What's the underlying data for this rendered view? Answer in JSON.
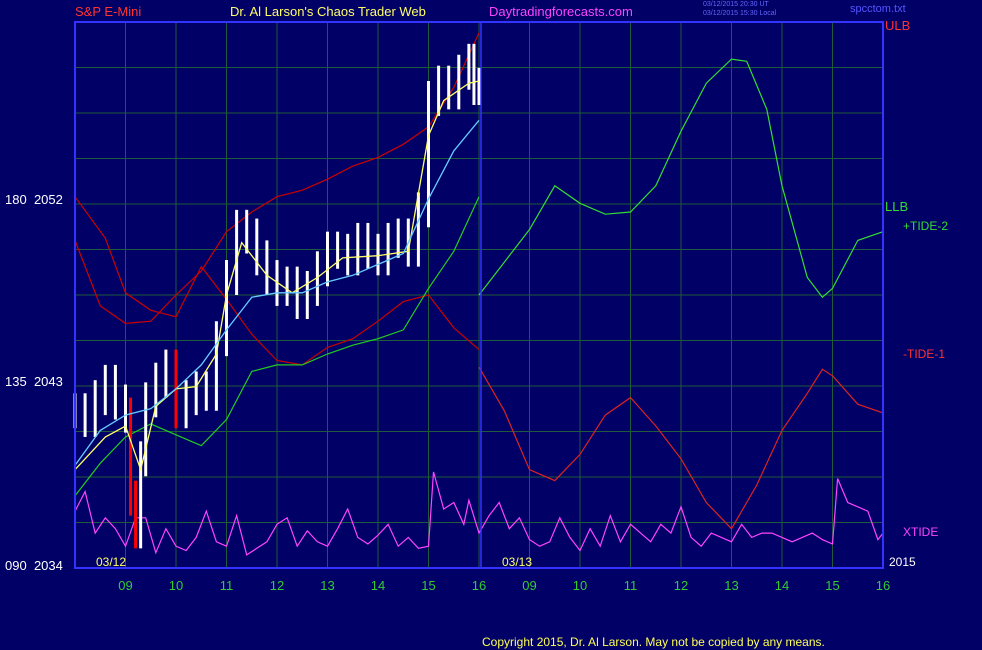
{
  "header": {
    "instrument": "S&P E-Mini",
    "site_title": "Dr. Al Larson's Chaos Trader Web",
    "url": "Daytradingforecasts.com",
    "stamp_ut": "03/12/2015 20:30 UT",
    "stamp_local": "03/12/2015 15:30 Local",
    "file_name": "spcctom.txt"
  },
  "footer": {
    "copyright": "Copyright 2015, Dr. Al Larson. May not be copied by any means."
  },
  "colors": {
    "background": "#000066",
    "frame": "#3333ff",
    "grid": "#1f5a3a",
    "price": "#ffffff",
    "down_bar": "#ff0000",
    "fast_ma": "#ffff66",
    "slow_ma": "#66ccff",
    "ulb": "#cc0000",
    "llb": "#22cc22",
    "tide_plus": "#33dd33",
    "tide_minus": "#dd2222",
    "xtide": "#ff44ff"
  },
  "chart_data": {
    "type": "line",
    "title": "S&P E-Mini",
    "y_axis": {
      "ticks": [
        {
          "angle": "180",
          "price": "2052"
        },
        {
          "angle": "135",
          "price": "2043"
        },
        {
          "angle": "090",
          "price": "2034"
        }
      ],
      "ylim": [
        2034,
        2059
      ]
    },
    "x_axis": {
      "day_labels": [
        "03/12",
        "03/13"
      ],
      "ticks": [
        "09",
        "10",
        "11",
        "12",
        "13",
        "14",
        "15",
        "16",
        "09",
        "10",
        "11",
        "12",
        "13",
        "14",
        "15",
        "16"
      ],
      "year": "2015",
      "xlim": [
        8,
        24
      ]
    },
    "grid": true,
    "series_labels": {
      "ulb": "ULB",
      "llb": "LLB",
      "tide_plus": "+TIDE-2",
      "tide_minus": "-TIDE-1",
      "xtide": "XTIDE"
    },
    "price_close": [
      [
        8.0,
        2041.2
      ],
      [
        8.2,
        2040.8
      ],
      [
        8.4,
        2041.8
      ],
      [
        8.6,
        2042.5
      ],
      [
        8.8,
        2041.6
      ],
      [
        9.0,
        2041.0
      ],
      [
        9.1,
        2037.2
      ],
      [
        9.2,
        2035.7
      ],
      [
        9.3,
        2039.0
      ],
      [
        9.4,
        2041.7
      ],
      [
        9.6,
        2042.6
      ],
      [
        9.8,
        2043.2
      ],
      [
        10.0,
        2041.2
      ],
      [
        10.2,
        2041.8
      ],
      [
        10.4,
        2042.2
      ],
      [
        10.6,
        2042.0
      ],
      [
        10.8,
        2044.5
      ],
      [
        11.0,
        2047.3
      ],
      [
        11.2,
        2049.6
      ],
      [
        11.4,
        2049.2
      ],
      [
        11.6,
        2048.2
      ],
      [
        11.8,
        2047.3
      ],
      [
        12.0,
        2046.8
      ],
      [
        12.2,
        2047.0
      ],
      [
        12.4,
        2046.2
      ],
      [
        12.6,
        2046.8
      ],
      [
        12.8,
        2047.7
      ],
      [
        13.0,
        2048.6
      ],
      [
        13.2,
        2048.5
      ],
      [
        13.4,
        2048.2
      ],
      [
        13.6,
        2049.0
      ],
      [
        13.8,
        2048.5
      ],
      [
        14.0,
        2048.2
      ],
      [
        14.2,
        2049.0
      ],
      [
        14.4,
        2049.2
      ],
      [
        14.6,
        2048.6
      ],
      [
        14.8,
        2050.4
      ],
      [
        15.0,
        2055.5
      ],
      [
        15.2,
        2056.2
      ],
      [
        15.4,
        2055.8
      ],
      [
        15.6,
        2056.7
      ],
      [
        15.8,
        2057.2
      ],
      [
        15.9,
        2056.0
      ],
      [
        16.0,
        2056.1
      ]
    ],
    "fast_ma": [
      [
        8.0,
        2038.5
      ],
      [
        8.6,
        2040.0
      ],
      [
        9.0,
        2040.5
      ],
      [
        9.3,
        2038.5
      ],
      [
        9.6,
        2041.4
      ],
      [
        10.0,
        2042.2
      ],
      [
        10.4,
        2042.3
      ],
      [
        10.8,
        2043.8
      ],
      [
        11.0,
        2046.5
      ],
      [
        11.3,
        2048.9
      ],
      [
        11.8,
        2047.4
      ],
      [
        12.3,
        2046.6
      ],
      [
        12.8,
        2047.3
      ],
      [
        13.3,
        2048.2
      ],
      [
        14.0,
        2048.3
      ],
      [
        14.6,
        2048.5
      ],
      [
        15.0,
        2053.8
      ],
      [
        15.3,
        2055.4
      ],
      [
        15.8,
        2056.2
      ],
      [
        16.0,
        2056.3
      ]
    ],
    "slow_ma": [
      [
        8.0,
        2038.7
      ],
      [
        8.5,
        2040.3
      ],
      [
        9.0,
        2041.0
      ],
      [
        9.5,
        2041.3
      ],
      [
        10.0,
        2042.2
      ],
      [
        10.5,
        2043.3
      ],
      [
        11.0,
        2044.9
      ],
      [
        11.5,
        2046.4
      ],
      [
        12.0,
        2046.6
      ],
      [
        12.5,
        2046.6
      ],
      [
        13.0,
        2047.1
      ],
      [
        13.5,
        2047.4
      ],
      [
        14.0,
        2047.9
      ],
      [
        14.5,
        2048.4
      ],
      [
        15.0,
        2050.9
      ],
      [
        15.5,
        2053.1
      ],
      [
        16.0,
        2054.5
      ]
    ],
    "ulb": [
      [
        8.0,
        2049.0
      ],
      [
        8.5,
        2046.0
      ],
      [
        9.0,
        2045.2
      ],
      [
        9.5,
        2045.3
      ],
      [
        10.0,
        2046.5
      ],
      [
        10.5,
        2047.6
      ],
      [
        11.0,
        2049.4
      ],
      [
        11.5,
        2050.3
      ],
      [
        12.0,
        2051.0
      ],
      [
        12.5,
        2051.3
      ],
      [
        13.0,
        2051.8
      ],
      [
        13.5,
        2052.4
      ],
      [
        14.0,
        2052.8
      ],
      [
        14.5,
        2053.4
      ],
      [
        15.0,
        2054.2
      ],
      [
        15.5,
        2056.0
      ],
      [
        16.0,
        2058.5
      ]
    ],
    "ulb_tail": [
      [
        8.0,
        2051.0
      ],
      [
        8.6,
        2049.1
      ],
      [
        9.0,
        2046.6
      ],
      [
        9.5,
        2045.8
      ],
      [
        10.0,
        2045.5
      ],
      [
        10.5,
        2047.8
      ],
      [
        11.0,
        2046.3
      ],
      [
        11.5,
        2044.7
      ],
      [
        12.0,
        2043.5
      ],
      [
        12.5,
        2043.3
      ],
      [
        13.0,
        2044.1
      ],
      [
        13.5,
        2044.5
      ],
      [
        14.0,
        2045.3
      ],
      [
        14.5,
        2046.2
      ],
      [
        15.0,
        2046.5
      ],
      [
        15.5,
        2045.0
      ],
      [
        16.0,
        2044.0
      ]
    ],
    "llb": [
      [
        8.0,
        2037.3
      ],
      [
        8.5,
        2038.8
      ],
      [
        9.0,
        2040.0
      ],
      [
        9.5,
        2040.6
      ],
      [
        10.0,
        2040.1
      ],
      [
        10.5,
        2039.6
      ],
      [
        11.0,
        2040.8
      ],
      [
        11.5,
        2043.0
      ],
      [
        12.0,
        2043.3
      ],
      [
        12.5,
        2043.3
      ],
      [
        13.0,
        2043.8
      ],
      [
        13.5,
        2044.2
      ],
      [
        14.0,
        2044.5
      ],
      [
        14.5,
        2044.9
      ],
      [
        15.0,
        2046.8
      ],
      [
        15.5,
        2048.5
      ],
      [
        16.0,
        2051.0
      ]
    ],
    "tide_plus": [
      [
        16.0,
        2046.5
      ],
      [
        16.5,
        2048.0
      ],
      [
        17.0,
        2049.5
      ],
      [
        17.5,
        2051.5
      ],
      [
        18.0,
        2050.7
      ],
      [
        18.5,
        2050.2
      ],
      [
        19.0,
        2050.3
      ],
      [
        19.5,
        2051.5
      ],
      [
        20.0,
        2054.0
      ],
      [
        20.5,
        2056.2
      ],
      [
        21.0,
        2057.3
      ],
      [
        21.3,
        2057.2
      ],
      [
        21.7,
        2055.0
      ],
      [
        22.0,
        2051.5
      ],
      [
        22.5,
        2047.3
      ],
      [
        22.8,
        2046.4
      ],
      [
        23.0,
        2046.8
      ],
      [
        23.5,
        2049.0
      ],
      [
        24.0,
        2049.4
      ]
    ],
    "tide_minus": [
      [
        16.0,
        2043.2
      ],
      [
        16.5,
        2041.2
      ],
      [
        17.0,
        2038.5
      ],
      [
        17.5,
        2038.0
      ],
      [
        18.0,
        2039.2
      ],
      [
        18.5,
        2041.0
      ],
      [
        19.0,
        2041.8
      ],
      [
        19.5,
        2040.5
      ],
      [
        20.0,
        2039.0
      ],
      [
        20.5,
        2037.0
      ],
      [
        21.0,
        2035.8
      ],
      [
        21.5,
        2037.8
      ],
      [
        22.0,
        2040.3
      ],
      [
        22.5,
        2042.0
      ],
      [
        22.8,
        2043.1
      ],
      [
        23.0,
        2042.8
      ],
      [
        23.5,
        2041.5
      ],
      [
        24.0,
        2041.1
      ]
    ],
    "xtide": [
      [
        8.0,
        2036.6
      ],
      [
        8.2,
        2037.5
      ],
      [
        8.4,
        2035.6
      ],
      [
        8.6,
        2036.3
      ],
      [
        8.8,
        2035.8
      ],
      [
        9.0,
        2035.0
      ],
      [
        9.2,
        2036.3
      ],
      [
        9.4,
        2036.3
      ],
      [
        9.6,
        2034.7
      ],
      [
        9.8,
        2035.8
      ],
      [
        10.0,
        2035.0
      ],
      [
        10.2,
        2034.8
      ],
      [
        10.4,
        2035.4
      ],
      [
        10.6,
        2036.6
      ],
      [
        10.8,
        2035.2
      ],
      [
        11.0,
        2035.0
      ],
      [
        11.2,
        2036.4
      ],
      [
        11.4,
        2034.6
      ],
      [
        11.6,
        2034.9
      ],
      [
        11.8,
        2035.2
      ],
      [
        12.0,
        2036.0
      ],
      [
        12.2,
        2036.3
      ],
      [
        12.4,
        2035.0
      ],
      [
        12.6,
        2035.7
      ],
      [
        12.8,
        2035.2
      ],
      [
        13.0,
        2035.0
      ],
      [
        13.2,
        2035.8
      ],
      [
        13.4,
        2036.7
      ],
      [
        13.6,
        2035.4
      ],
      [
        13.8,
        2035.1
      ],
      [
        14.0,
        2035.5
      ],
      [
        14.2,
        2036.0
      ],
      [
        14.4,
        2035.0
      ],
      [
        14.6,
        2035.4
      ],
      [
        14.8,
        2034.9
      ],
      [
        15.0,
        2035.0
      ],
      [
        15.1,
        2038.4
      ],
      [
        15.3,
        2036.7
      ],
      [
        15.5,
        2037.0
      ],
      [
        15.7,
        2036.0
      ],
      [
        15.8,
        2037.1
      ],
      [
        16.0,
        2035.6
      ],
      [
        16.2,
        2036.4
      ],
      [
        16.4,
        2037.0
      ],
      [
        16.6,
        2035.8
      ],
      [
        16.8,
        2036.3
      ],
      [
        17.0,
        2035.3
      ],
      [
        17.2,
        2035.0
      ],
      [
        17.4,
        2035.2
      ],
      [
        17.6,
        2036.3
      ],
      [
        17.8,
        2035.4
      ],
      [
        18.0,
        2034.8
      ],
      [
        18.2,
        2035.8
      ],
      [
        18.4,
        2035.0
      ],
      [
        18.6,
        2036.4
      ],
      [
        18.8,
        2035.2
      ],
      [
        19.0,
        2036.0
      ],
      [
        19.2,
        2035.6
      ],
      [
        19.4,
        2035.2
      ],
      [
        19.6,
        2036.0
      ],
      [
        19.8,
        2035.6
      ],
      [
        20.0,
        2036.8
      ],
      [
        20.2,
        2035.4
      ],
      [
        20.4,
        2035.0
      ],
      [
        20.6,
        2035.6
      ],
      [
        20.8,
        2035.4
      ],
      [
        21.0,
        2035.2
      ],
      [
        21.2,
        2036.0
      ],
      [
        21.4,
        2035.4
      ],
      [
        21.6,
        2035.6
      ],
      [
        21.8,
        2035.6
      ],
      [
        22.0,
        2035.4
      ],
      [
        22.2,
        2035.2
      ],
      [
        22.4,
        2035.4
      ],
      [
        22.6,
        2035.6
      ],
      [
        22.8,
        2035.3
      ],
      [
        23.0,
        2035.1
      ],
      [
        23.1,
        2038.1
      ],
      [
        23.3,
        2037.0
      ],
      [
        23.5,
        2036.8
      ],
      [
        23.7,
        2036.6
      ],
      [
        23.9,
        2035.3
      ],
      [
        24.0,
        2035.6
      ]
    ]
  }
}
